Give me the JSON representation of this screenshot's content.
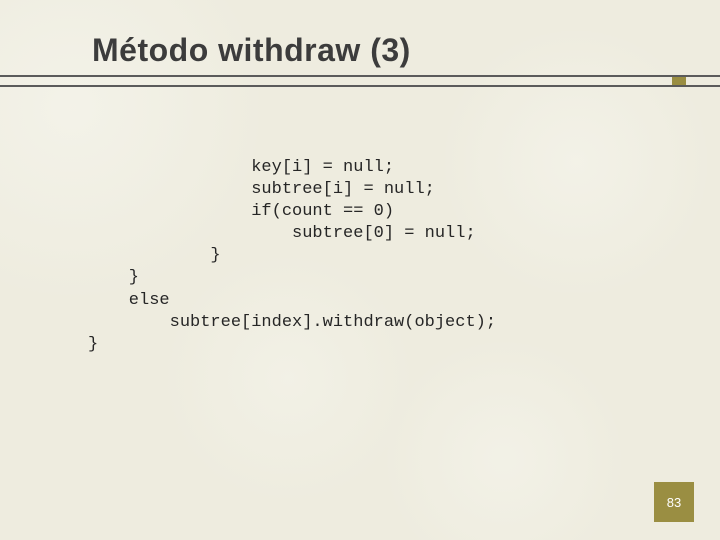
{
  "title": "Método withdraw (3)",
  "code_lines": [
    "                key[i] = null;",
    "                subtree[i] = null;",
    "                if(count == 0)",
    "                    subtree[0] = null;",
    "            }",
    "    }",
    "    else",
    "        subtree[index].withdraw(object);",
    "}"
  ],
  "page_number": "83"
}
